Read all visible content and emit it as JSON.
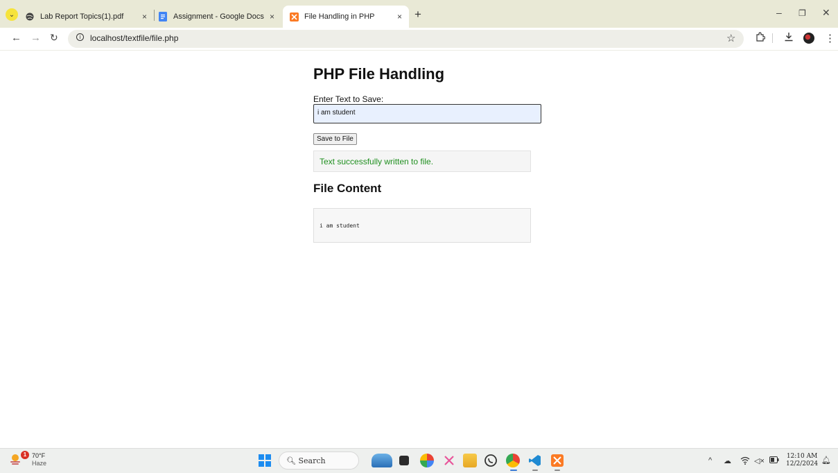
{
  "browser": {
    "tabs": [
      {
        "label": "Lab Report Topics(1).pdf",
        "icon": "globe-icon",
        "active": false
      },
      {
        "label": "Assignment - Google Docs",
        "icon": "google-docs-icon",
        "active": false
      },
      {
        "label": "File Handling in PHP",
        "icon": "xampp-icon",
        "active": true
      }
    ],
    "new_tab": "+",
    "close_glyph": "×",
    "url": "localhost/textfile/file.php"
  },
  "page": {
    "title": "PHP File Handling",
    "input_label": "Enter Text to Save:",
    "input_value": "i am student",
    "save_button": "Save to File",
    "success_message": "Text successfully written to file.",
    "file_content_heading": "File Content",
    "file_content": "i am student"
  },
  "taskbar": {
    "weather_temp": "70°F",
    "weather_desc": "Haze",
    "weather_badge": "1",
    "search_placeholder": "Search",
    "clock_time": "12:10 AM",
    "clock_date": "12/2/2024"
  },
  "colors": {
    "tabbar": "#e9e9d6",
    "success_text": "#1f8f1f",
    "input_bg": "#e8f0fe"
  }
}
